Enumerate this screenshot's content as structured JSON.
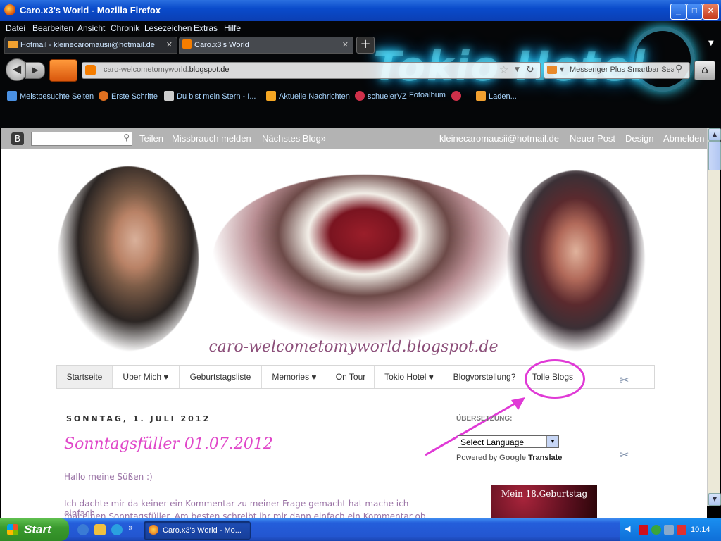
{
  "window": {
    "title": "Caro.x3's World - Mozilla Firefox"
  },
  "menu": [
    "Datei",
    "Bearbeiten",
    "Ansicht",
    "Chronik",
    "Lesezeichen",
    "Extras",
    "Hilfe"
  ],
  "tabs": [
    {
      "label": "Hotmail - kleinecaromausii@hotmail.de"
    },
    {
      "label": "Caro.x3's World"
    }
  ],
  "urlbar": {
    "prefix": "caro-welcometomyworld.",
    "domain": "blogspot.de"
  },
  "searchbar": {
    "placeholder": "Messenger Plus Smartbar Search"
  },
  "bookmarks": [
    "Meistbesuchte Seiten",
    "Erste Schritte",
    "Du bist mein Stern - I...",
    "Aktuelle Nachrichten",
    "schuelerVZ",
    "Fotoalbum",
    "Laden..."
  ],
  "theme": {
    "logo_text": "Tokio Hotel"
  },
  "navbar": {
    "links": [
      "Teilen",
      "Missbrauch melden",
      "Nächstes Blog»"
    ],
    "email": "kleinecaromausii@hotmail.de",
    "right_links": [
      "Neuer Post",
      "Design",
      "Abmelden"
    ]
  },
  "blog": {
    "header_url": "caro-welcometomyworld.blogspot.de",
    "tabs": [
      "Startseite",
      "Über Mich ♥",
      "Geburtstagsliste",
      "Memories ♥",
      "On Tour",
      "Tokio Hotel ♥",
      "Blogvorstellung?",
      "Tolle Blogs"
    ],
    "date": "SONNTAG, 1. JULI 2012",
    "post_title": "Sonntagsfüller 01.07.2012",
    "post_lines": [
      "Hallo meine Süßen :)",
      "Ich dachte mir da keiner ein Kommentar zu meiner Frage gemacht hat mache ich einfach",
      "mal einen Sonntagsfüller. Am besten schreibt ihr mir dann einfach ein Kommentar ob"
    ]
  },
  "sidebar": {
    "title": "ÜBERSETZUNG:",
    "select_value": "Select Language",
    "powered_prefix": "Powered by",
    "google": "Google",
    "translate": "Translate",
    "banner_text": "Mein 18.Geburtstag"
  },
  "taskbar": {
    "start": "Start",
    "item": "Caro.x3's World - Mo...",
    "clock": "10:14"
  },
  "colors": {
    "accent_pink": "#e047c9",
    "highlight": "#e03ad6",
    "xp_blue": "#245edb"
  }
}
